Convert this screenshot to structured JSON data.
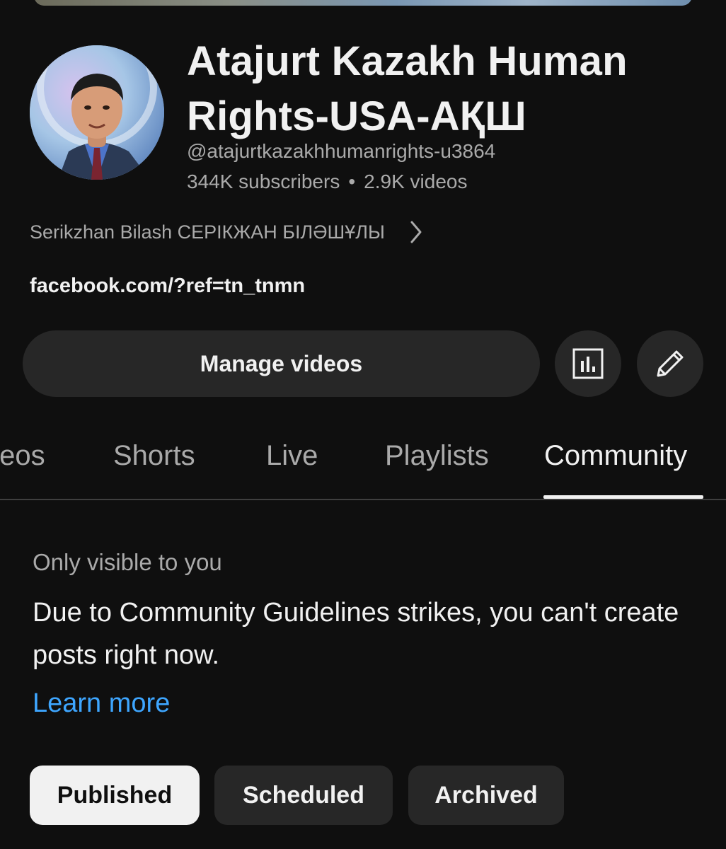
{
  "channel": {
    "title": "Atajurt Kazakh Human Rights-USA-АҚШ",
    "handle": "@atajurtkazakhhumanrights-u3864",
    "subscribers": "344K subscribers",
    "separator": "•",
    "videos": "2.9K videos",
    "description": "Serikzhan Bilash СЕРІКЖАН БІЛӘШҰЛЫ",
    "link": "facebook.com/?ref=tn_tnmn"
  },
  "actions": {
    "manage_label": "Manage videos",
    "analytics_icon": "analytics-icon",
    "edit_icon": "pencil-icon"
  },
  "tabs": [
    {
      "label": "Videos",
      "active": false
    },
    {
      "label": "Shorts",
      "active": false
    },
    {
      "label": "Live",
      "active": false
    },
    {
      "label": "Playlists",
      "active": false
    },
    {
      "label": "Community",
      "active": true
    }
  ],
  "community": {
    "visibility_label": "Only visible to you",
    "message": "Due to Community Guidelines strikes, you can't create posts right now.",
    "learn_more": "Learn more"
  },
  "filters": [
    {
      "label": "Published",
      "selected": true
    },
    {
      "label": "Scheduled",
      "selected": false
    },
    {
      "label": "Archived",
      "selected": false
    }
  ],
  "colors": {
    "background": "#0f0f0f",
    "surface": "#272727",
    "link": "#3ea6ff",
    "secondary_text": "#aaaaaa"
  }
}
